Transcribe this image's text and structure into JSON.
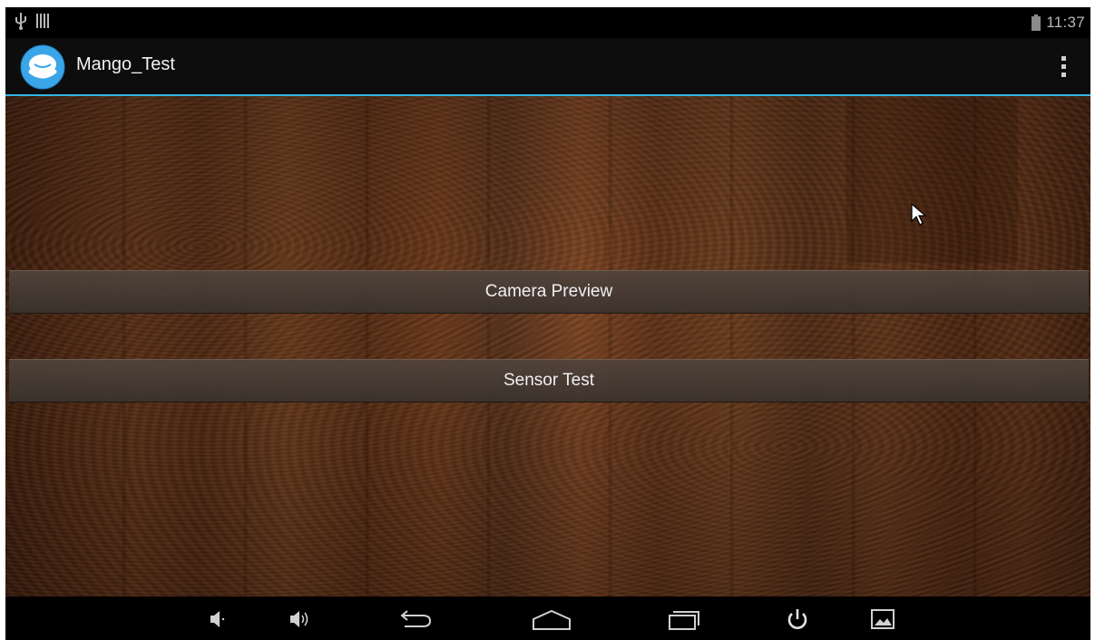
{
  "status_bar": {
    "time": "11:37",
    "icons": [
      "usb-icon",
      "barcode-notification-icon",
      "battery-icon"
    ]
  },
  "action_bar": {
    "title": "Mango_Test",
    "logo_icon": "mango-logo-icon",
    "overflow_icon": "overflow-menu-icon"
  },
  "main": {
    "buttons": [
      {
        "label": "Camera Preview"
      },
      {
        "label": "Sensor Test"
      }
    ]
  },
  "nav_bar": {
    "icons": [
      "volume-down-icon",
      "volume-up-icon",
      "back-icon",
      "home-icon",
      "recent-apps-icon",
      "power-icon",
      "screenshot-icon"
    ]
  },
  "colors": {
    "accent": "#33b5e5",
    "logo_blue": "#3aa6e8",
    "status_text": "#b8b8b8"
  }
}
